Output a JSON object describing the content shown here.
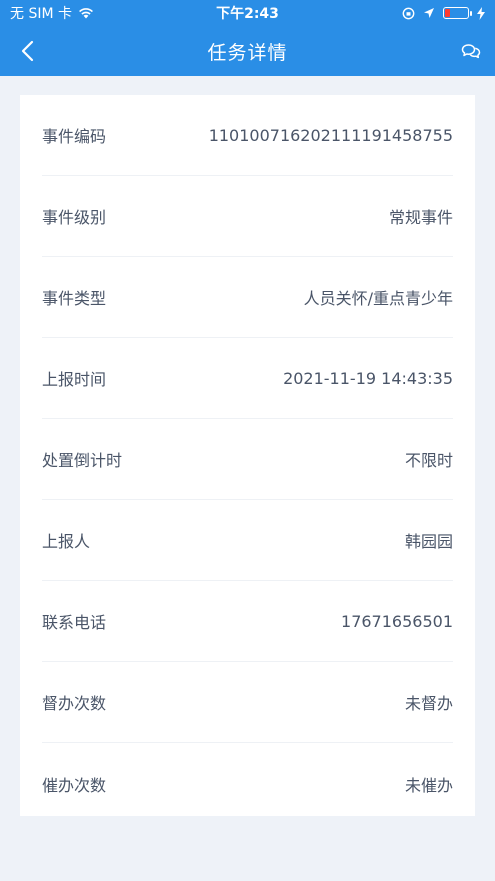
{
  "status_bar": {
    "carrier": "无 SIM 卡",
    "time": "下午2:43",
    "battery_color": "#ff3b30"
  },
  "navbar": {
    "title": "任务详情",
    "back_icon": "chevron-left-icon",
    "chat_icon": "chat-bubbles-icon",
    "bg_color": "#2a8ee6"
  },
  "details": [
    {
      "label": "事件编码",
      "value": "110100716202111191458755"
    },
    {
      "label": "事件级别",
      "value": "常规事件"
    },
    {
      "label": "事件类型",
      "value": "人员关怀/重点青少年"
    },
    {
      "label": "上报时间",
      "value": "2021-11-19 14:43:35"
    },
    {
      "label": "处置倒计时",
      "value": "不限时"
    },
    {
      "label": "上报人",
      "value": "韩园园"
    },
    {
      "label": "联系电话",
      "value": "17671656501"
    },
    {
      "label": "督办次数",
      "value": "未督办"
    },
    {
      "label": "催办次数",
      "value": "未催办"
    }
  ]
}
